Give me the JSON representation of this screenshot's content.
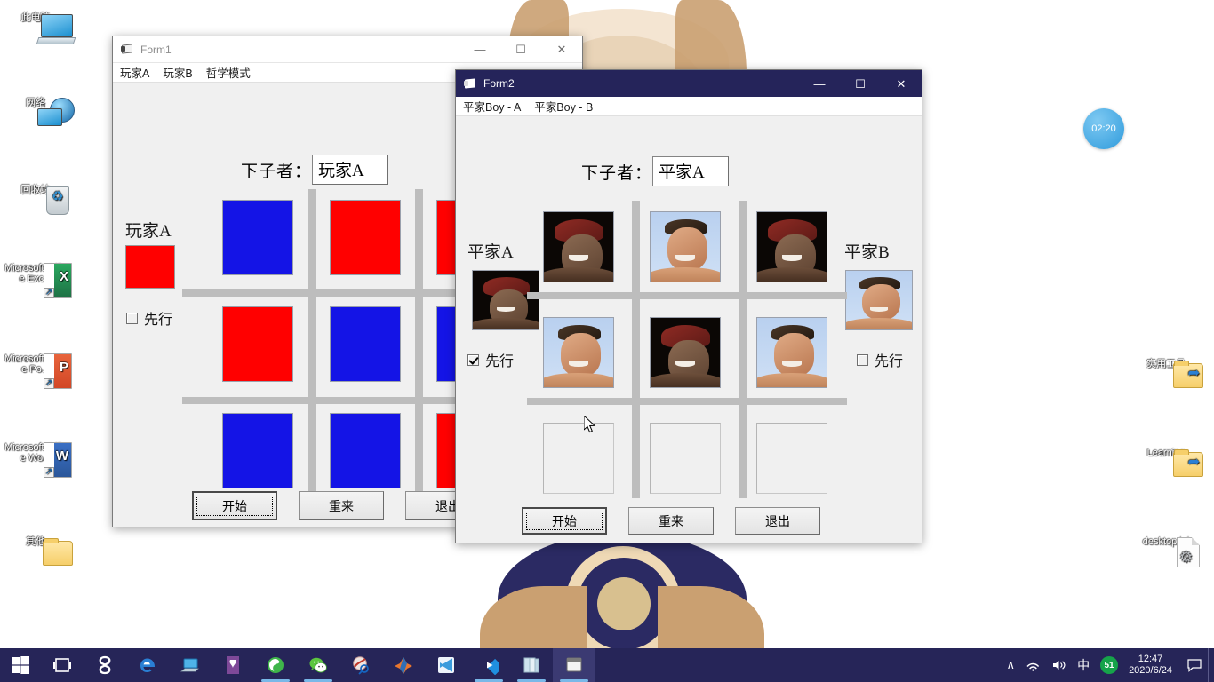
{
  "desktop": {
    "icons": [
      {
        "name": "this-pc",
        "label": "此电脑",
        "kind": "monitor"
      },
      {
        "name": "network",
        "label": "网络",
        "kind": "globe"
      },
      {
        "name": "recycle-bin",
        "label": "回收站",
        "kind": "bin"
      },
      {
        "name": "excel",
        "label": "Microsoft Office Exc...",
        "kind": "doc",
        "color": "#1e7145",
        "letter": "X"
      },
      {
        "name": "powerpoint",
        "label": "Microsoft Office Po...",
        "kind": "doc",
        "color": "#d24726",
        "letter": "P"
      },
      {
        "name": "word",
        "label": "Microsoft Office Wo...",
        "kind": "doc",
        "color": "#2b579a",
        "letter": "W"
      },
      {
        "name": "other-folder",
        "label": "其他",
        "kind": "folder-plain"
      },
      {
        "name": "tools-folder",
        "label": "实用工具",
        "kind": "folder"
      },
      {
        "name": "learning-folder",
        "label": "Learning",
        "kind": "folder"
      },
      {
        "name": "desktop-ini",
        "label": "desktop.ini",
        "kind": "ini"
      }
    ],
    "clock_bubble": "02:20"
  },
  "form1": {
    "title": "Form1",
    "title_icon": "form-icon",
    "menu": [
      "玩家A",
      "玩家B",
      "哲学模式"
    ],
    "window_buttons": {
      "minimize": "—",
      "maximize": "☐",
      "close": "✕"
    },
    "turn_label": "下子者：",
    "turn_value": "玩家A",
    "left_player": {
      "name": "玩家A",
      "color": "#ff0000",
      "first_label": "先行",
      "first_checked": false
    },
    "board": [
      [
        "B",
        "R",
        "R"
      ],
      [
        "R",
        "B",
        "B"
      ],
      [
        "B",
        "B",
        "R"
      ]
    ],
    "colors": {
      "R": "#ff0000",
      "B": "#1414e6"
    },
    "buttons": [
      {
        "name": "start",
        "label": "开始",
        "focused": true
      },
      {
        "name": "restart",
        "label": "重来",
        "focused": false
      },
      {
        "name": "exit",
        "label": "退出",
        "focused": false
      }
    ]
  },
  "form2": {
    "title": "Form2",
    "title_icon": "form-icon",
    "menu": [
      "平家Boy - A",
      "平家Boy - B"
    ],
    "window_buttons": {
      "minimize": "—",
      "maximize": "☐",
      "close": "✕"
    },
    "turn_label": "下子者：",
    "turn_value": "平家A",
    "left_player": {
      "name": "平家A",
      "portrait": "portrait-a",
      "first_label": "先行",
      "first_checked": true
    },
    "right_player": {
      "name": "平家B",
      "portrait": "portrait-b",
      "first_label": "先行",
      "first_checked": false
    },
    "board": [
      [
        "A",
        "B",
        "A"
      ],
      [
        "B",
        "A",
        "B"
      ],
      [
        "",
        "",
        ""
      ]
    ],
    "buttons": [
      {
        "name": "start",
        "label": "开始",
        "focused": true
      },
      {
        "name": "restart",
        "label": "重来",
        "focused": false
      },
      {
        "name": "exit",
        "label": "退出",
        "focused": false
      }
    ]
  },
  "taskbar": {
    "start_icon": "windows-logo-icon",
    "task_view_icon": "task-view-icon",
    "items": [
      {
        "name": "sogou",
        "icon": "sogou-icon",
        "running": false
      },
      {
        "name": "edge",
        "icon": "edge-icon",
        "running": false
      },
      {
        "name": "remote-desktop",
        "icon": "remote-desktop-icon",
        "running": false
      },
      {
        "name": "onenote",
        "icon": "onenote-icon",
        "running": false
      },
      {
        "name": "browser-360",
        "icon": "360-browser-icon",
        "running": true
      },
      {
        "name": "wechat",
        "icon": "wechat-icon",
        "running": true
      },
      {
        "name": "graphics-app",
        "icon": "graphics-icon",
        "running": false
      },
      {
        "name": "matlab",
        "icon": "matlab-icon",
        "running": false
      },
      {
        "name": "visual-studio",
        "icon": "visual-studio-icon",
        "running": false
      },
      {
        "name": "media-player",
        "icon": "media-player-icon",
        "running": true
      },
      {
        "name": "explorer-books",
        "icon": "explorer-icon",
        "running": true
      },
      {
        "name": "form-app",
        "icon": "form-app-icon",
        "running": true,
        "active": true
      }
    ],
    "tray": {
      "chevron": "∧",
      "network_icon": "wifi-icon",
      "volume_icon": "speaker-icon",
      "ime": "中",
      "badge": "51",
      "time": "12:47",
      "date": "2020/6/24",
      "action_center_icon": "notification-icon"
    }
  }
}
